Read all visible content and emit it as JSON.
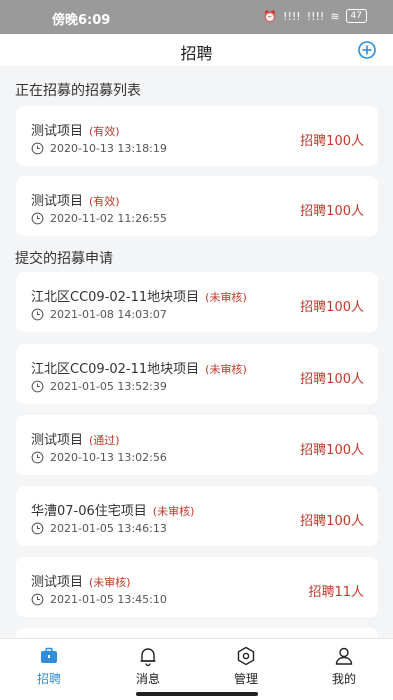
{
  "status_bar": {
    "time": "傍晚6:09",
    "signal": "!!!!",
    "signal2": "!!!!",
    "battery": "47"
  },
  "header": {
    "title": "招聘",
    "add_icon": "plus-circle-icon"
  },
  "sections": {
    "active_title": "正在招募的招募列表",
    "submitted_title": "提交的招募申请"
  },
  "active_list": [
    {
      "name": "测试项目",
      "status": "(有效)",
      "time": "2020-10-13 13:18:19",
      "count": "招聘100人"
    },
    {
      "name": "测试项目",
      "status": "(有效)",
      "time": "2020-11-02 11:26:55",
      "count": "招聘100人"
    }
  ],
  "submitted_list": [
    {
      "name": "江北区CC09-02-11地块项目",
      "status": "(未审核)",
      "time": "2021-01-08 14:03:07",
      "count": "招聘100人"
    },
    {
      "name": "江北区CC09-02-11地块项目",
      "status": "(未审核)",
      "time": "2021-01-05 13:52:39",
      "count": "招聘100人"
    },
    {
      "name": "测试项目",
      "status": "(通过)",
      "time": "2020-10-13 13:02:56",
      "count": "招聘100人"
    },
    {
      "name": "华漕07-06住宅项目",
      "status": "(未审核)",
      "time": "2021-01-05 13:46:13",
      "count": "招聘100人"
    },
    {
      "name": "测试项目",
      "status": "(未审核)",
      "time": "2021-01-05 13:45:10",
      "count": "招聘11人"
    }
  ],
  "tabs": [
    {
      "label": "招聘",
      "icon": "briefcase-icon",
      "active": true
    },
    {
      "label": "消息",
      "icon": "bell-icon",
      "active": false
    },
    {
      "label": "管理",
      "icon": "hexagon-icon",
      "active": false
    },
    {
      "label": "我的",
      "icon": "user-icon",
      "active": false
    }
  ],
  "colors": {
    "accent": "#2f8ddb",
    "status_red": "#c0392b"
  }
}
